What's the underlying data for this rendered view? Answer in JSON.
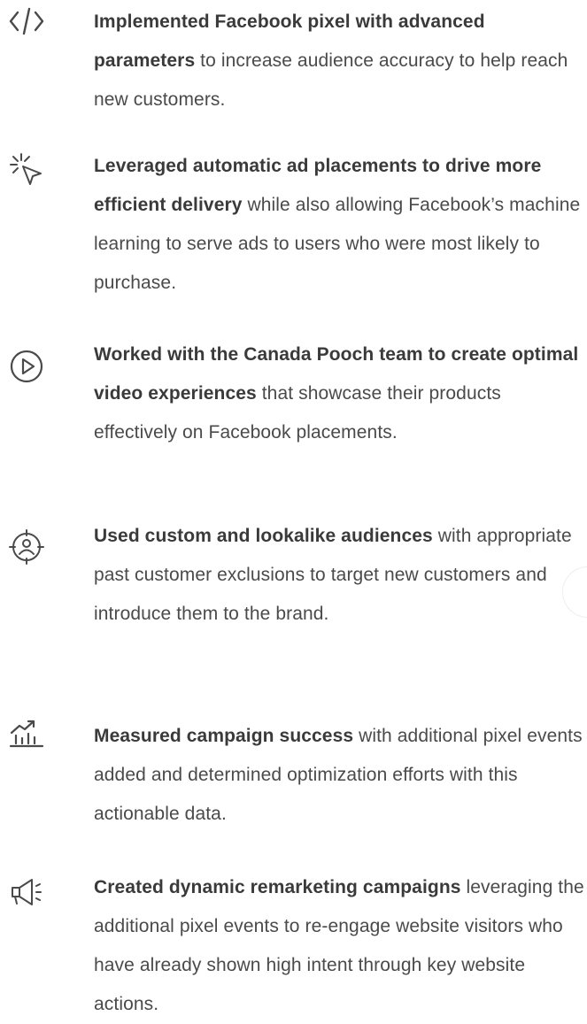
{
  "items": [
    {
      "icon": "code-icon",
      "bold": "Implemented Facebook pixel with advanced parameters",
      "rest": " to increase audience accuracy to help reach new customers."
    },
    {
      "icon": "cursor-click-icon",
      "bold": "Leveraged automatic ad placements to drive more efficient delivery",
      "rest": " while also allowing Facebook’s machine learning to serve ads to users who were most likely to purchase."
    },
    {
      "icon": "play-circle-icon",
      "bold": "Worked with the Canada Pooch team to create optimal video experiences",
      "rest": " that showcase their products effectively on Facebook placements."
    },
    {
      "icon": "target-user-icon",
      "bold": "Used custom and lookalike audiences",
      "rest": " with appropriate past customer exclusions to target new customers and introduce them to the brand."
    },
    {
      "icon": "growth-chart-icon",
      "bold": "Measured campaign success",
      "rest": " with additional pixel events added and determined optimization efforts with this actionable data."
    },
    {
      "icon": "megaphone-icon",
      "bold": "Created dynamic remarketing campaigns",
      "rest": " leveraging the additional pixel events to re-engage website visitors who have already shown high intent through key website actions."
    }
  ],
  "colors": {
    "icon": "#4a4a4a",
    "text": "#4a4a4a",
    "background": "#ffffff"
  }
}
